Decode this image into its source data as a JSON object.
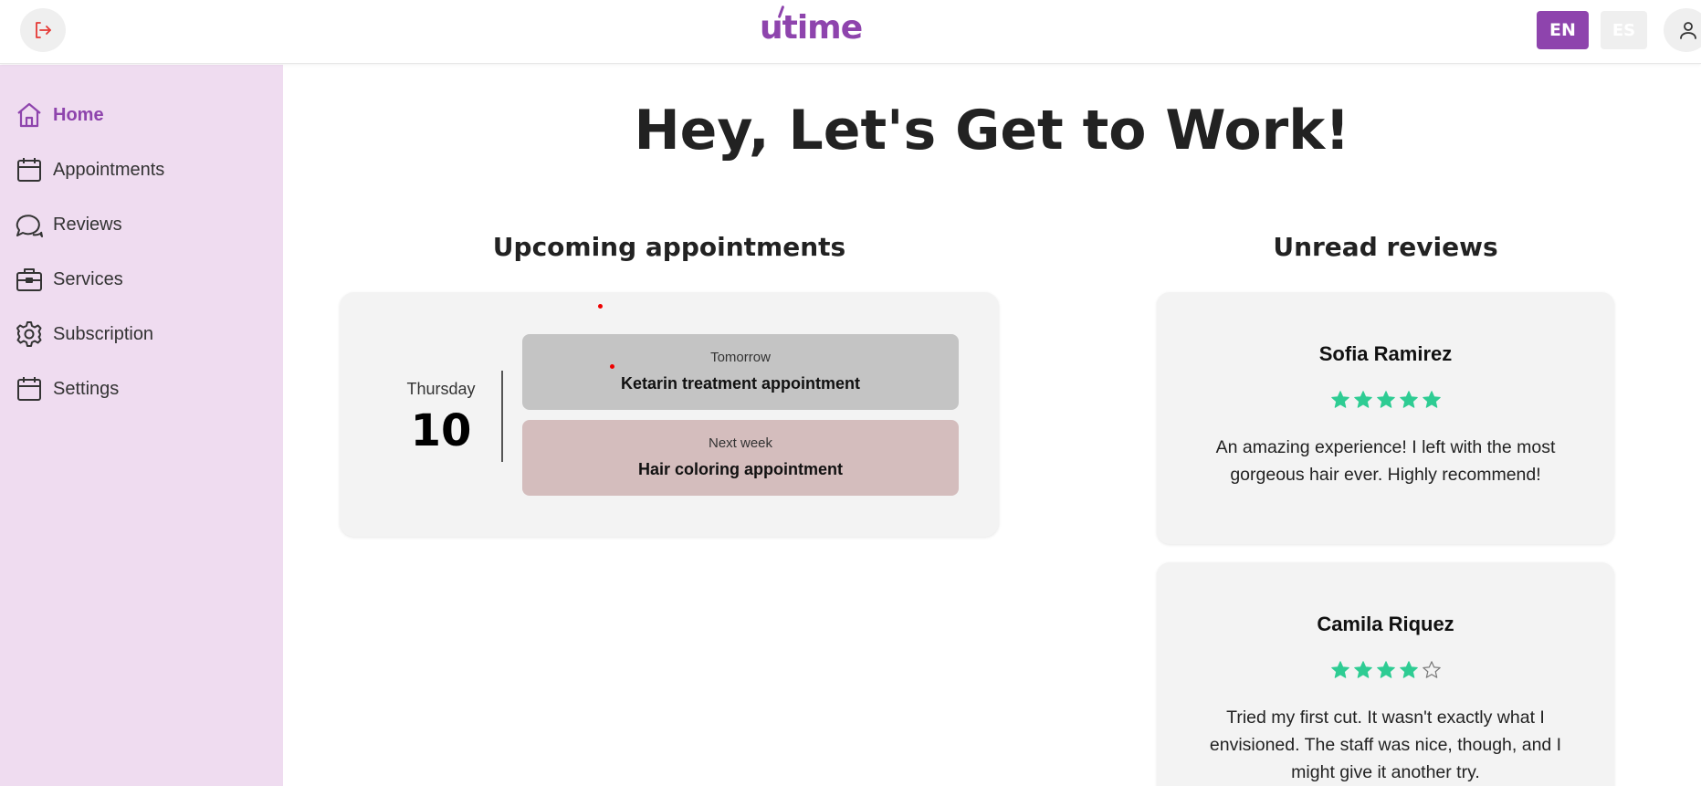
{
  "header": {
    "logo_text": "utime",
    "lang_en": "EN",
    "lang_es": "ES",
    "brand_color": "#8e44ad"
  },
  "sidebar": {
    "items": [
      {
        "label": "Home",
        "icon": "home-icon",
        "active": true
      },
      {
        "label": "Appointments",
        "icon": "calendar-icon"
      },
      {
        "label": "Reviews",
        "icon": "chat-bubbles-icon"
      },
      {
        "label": "Services",
        "icon": "briefcase-icon"
      },
      {
        "label": "Subscription",
        "icon": "gear-icon"
      },
      {
        "label": "Settings",
        "icon": "calendar-icon"
      }
    ]
  },
  "main": {
    "headline": "Hey, Let's Get to Work!",
    "appointments": {
      "title": "Upcoming appointments",
      "day_name": "Thursday",
      "day_number": "10",
      "items": [
        {
          "when": "Tomorrow",
          "what": "Ketarin treatment appointment",
          "color": "#c4c4c4"
        },
        {
          "when": "Next week",
          "what": "Hair coloring appointment",
          "color": "#d4bdbd"
        }
      ]
    },
    "reviews": {
      "title": "Unread reviews",
      "star_color": "#2ecc93",
      "items": [
        {
          "name": "Sofia Ramirez",
          "rating": 5,
          "text": "An amazing experience! I left with the most gorgeous hair ever. Highly recommend!"
        },
        {
          "name": "Camila Riquez",
          "rating": 4,
          "text": "Tried my first cut. It wasn't exactly what I envisioned. The staff was nice, though, and I might give it another try."
        }
      ]
    }
  }
}
